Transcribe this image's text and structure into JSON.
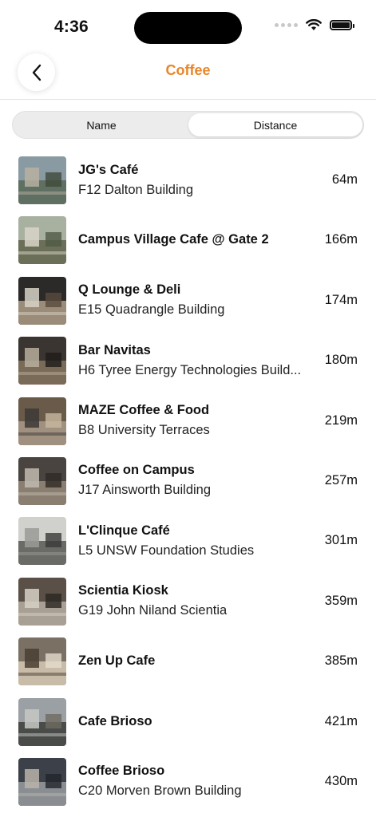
{
  "status_bar": {
    "time": "4:36"
  },
  "header": {
    "title": "Coffee",
    "title_color": "#e8862a"
  },
  "sort_control": {
    "options": [
      "Name",
      "Distance"
    ],
    "selected": "Distance"
  },
  "cafes": [
    {
      "name": "JG's Café",
      "location": "F12 Dalton Building",
      "distance": "64m"
    },
    {
      "name": "Campus Village Cafe @ Gate 2",
      "location": "",
      "distance": "166m"
    },
    {
      "name": "Q Lounge & Deli",
      "location": "E15 Quadrangle Building",
      "distance": "174m"
    },
    {
      "name": "Bar Navitas",
      "location": "H6 Tyree Energy Technologies Build...",
      "distance": "180m"
    },
    {
      "name": "MAZE Coffee & Food",
      "location": "B8 University Terraces",
      "distance": "219m"
    },
    {
      "name": "Coffee on Campus",
      "location": "J17 Ainsworth Building",
      "distance": "257m"
    },
    {
      "name": "L'Clinque Café",
      "location": "L5 UNSW Foundation Studies",
      "distance": "301m"
    },
    {
      "name": "Scientia Kiosk",
      "location": "G19 John Niland Scientia",
      "distance": "359m"
    },
    {
      "name": "Zen Up Cafe",
      "location": "",
      "distance": "385m"
    },
    {
      "name": "Cafe Brioso",
      "location": "",
      "distance": "421m"
    },
    {
      "name": "Coffee Brioso",
      "location": "C20 Morven Brown Building",
      "distance": "430m"
    }
  ]
}
